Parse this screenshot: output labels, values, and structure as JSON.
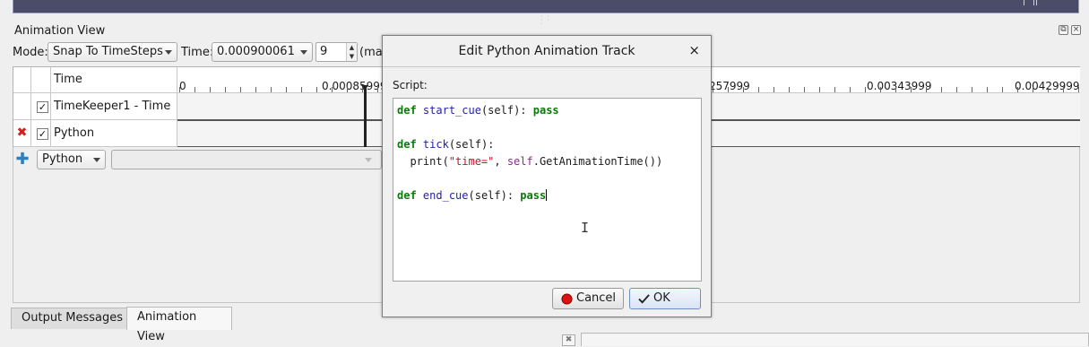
{
  "panel": {
    "title": "Animation View"
  },
  "toolbar": {
    "mode_label": "Mode:",
    "mode_value": "Snap To TimeSteps",
    "time_label": "Time:",
    "time_value": "0.000900061",
    "step_value": "9",
    "max_label": "(max"
  },
  "table": {
    "header_time": "Time",
    "tick_labels": [
      "0",
      "0.00085999",
      "257999",
      "0.00343999",
      "0.00429999"
    ],
    "rows": [
      {
        "checked": true,
        "label": "TimeKeeper1 - Time"
      },
      {
        "checked": true,
        "label": "Python",
        "removable": true
      }
    ],
    "add_track_type": "Python",
    "add_track_source": ""
  },
  "tabs": [
    {
      "label": "Output Messages",
      "active": false
    },
    {
      "label": "Animation View",
      "active": true
    }
  ],
  "dialog": {
    "title": "Edit Python Animation Track",
    "close_glyph": "×",
    "script_label": "Script:",
    "code": {
      "l1_def": "def",
      "l1_name": "start_cue",
      "l1_args": "(self): ",
      "l1_pass": "pass",
      "l2_def": "def",
      "l2_name": "tick",
      "l2_args": "(self):",
      "l3_print": "  print(",
      "l3_str": "\"time=\"",
      "l3_comma": ", ",
      "l3_self": "self",
      "l3_call": ".GetAnimationTime())",
      "l4_def": "def",
      "l4_name": "end_cue",
      "l4_args": "(self): ",
      "l4_pass": "pass"
    },
    "cancel_label": "Cancel",
    "ok_label": "OK"
  },
  "colors": {
    "keyword": "#0a7a0a",
    "function": "#2222aa",
    "string": "#c4102a",
    "remove_icon": "#d22020",
    "add_icon": "#2a7fc4"
  },
  "icons": [
    "restore-icon",
    "close-panel-icon",
    "remove-track-icon",
    "add-track-icon",
    "cancel-icon",
    "ok-icon",
    "text-cursor-icon"
  ]
}
